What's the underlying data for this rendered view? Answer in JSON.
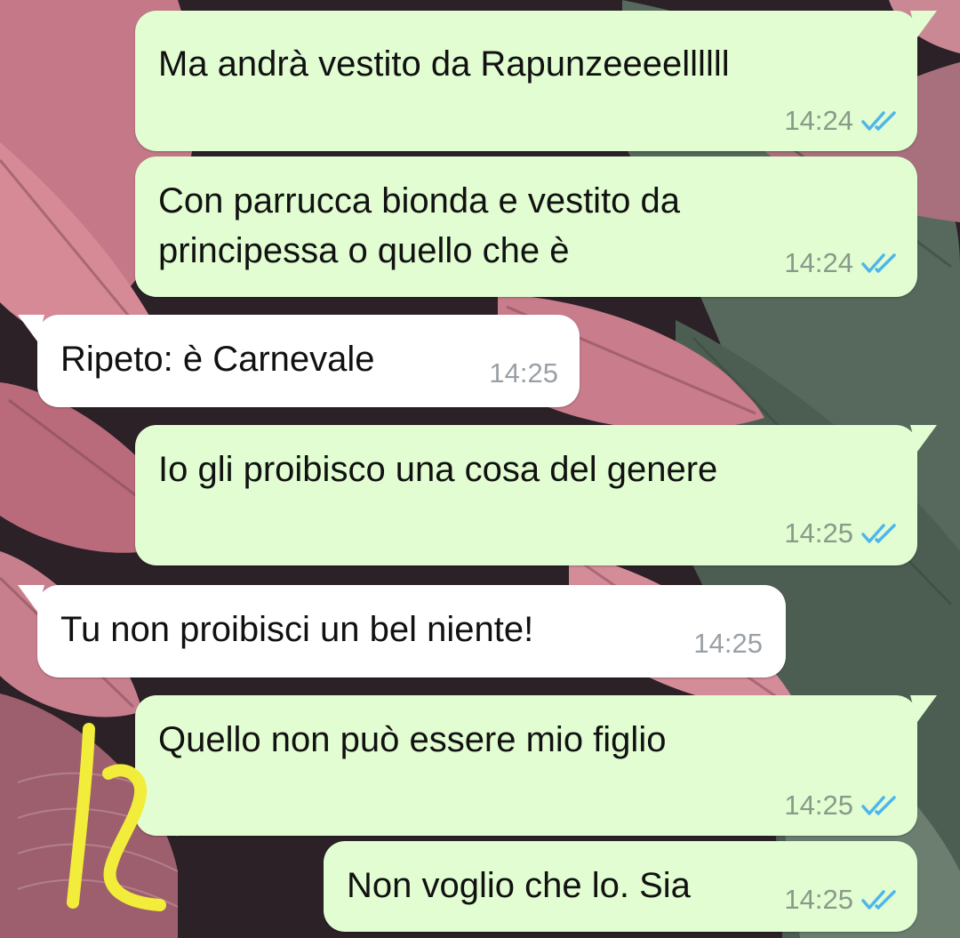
{
  "colors": {
    "outgoing_bubble": "#e1fdd1",
    "incoming_bubble": "#ffffff",
    "read_ticks": "#4fb6ec",
    "annotation": "#f2ec3a"
  },
  "messages": [
    {
      "direction": "outgoing",
      "text": "Ma andrà vestito da Rapunzeeeellllll",
      "time": "14:24",
      "status_icon": "double-check-icon"
    },
    {
      "direction": "outgoing",
      "text": "Con parrucca bionda e vestito da\nprincipessa o quello che è",
      "time": "14:24",
      "status_icon": "double-check-icon"
    },
    {
      "direction": "incoming",
      "text": "Ripeto: è Carnevale",
      "time": "14:25"
    },
    {
      "direction": "outgoing",
      "text": "Io gli proibisco una cosa del genere",
      "time": "14:25",
      "status_icon": "double-check-icon"
    },
    {
      "direction": "incoming",
      "text": "Tu non proibisci un bel niente!",
      "time": "14:25"
    },
    {
      "direction": "outgoing",
      "text": "Quello non può essere mio figlio",
      "time": "14:25",
      "status_icon": "double-check-icon"
    },
    {
      "direction": "outgoing",
      "text": "Non voglio che lo. Sia",
      "time": "14:25",
      "status_icon": "double-check-icon"
    }
  ]
}
